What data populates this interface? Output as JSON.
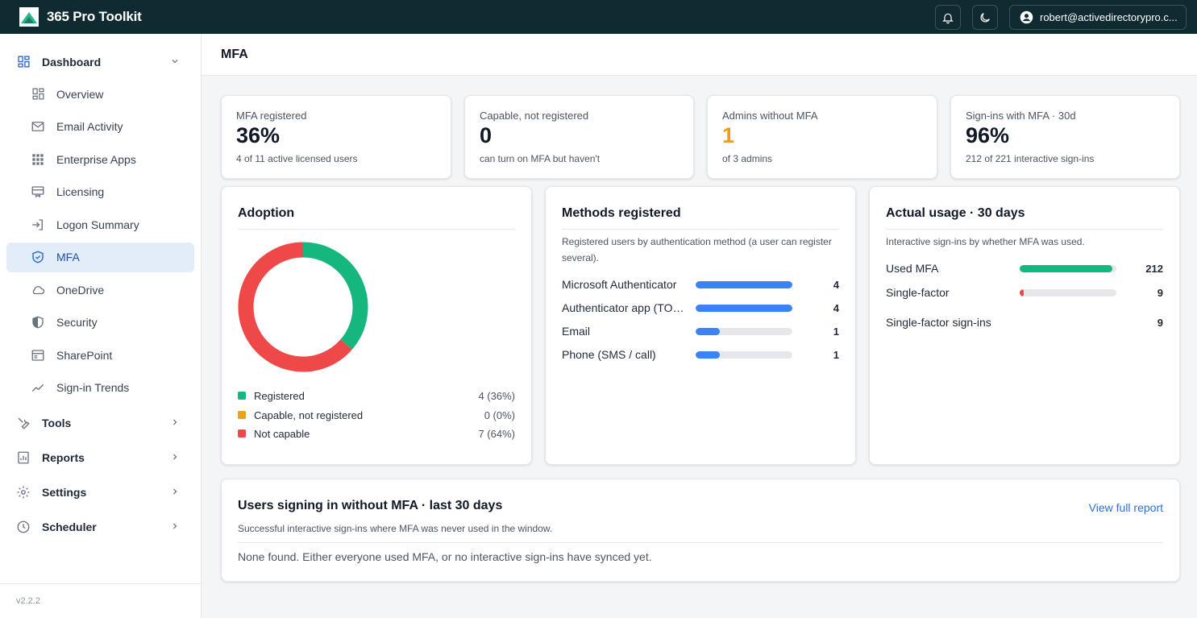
{
  "app": {
    "title": "365 Pro Toolkit",
    "user": "robert@activedirectorypro.c..."
  },
  "sidebar": {
    "dashboard": {
      "label": "Dashboard",
      "items": [
        {
          "label": "Overview",
          "icon": "grid-icon"
        },
        {
          "label": "Email Activity",
          "icon": "mail-icon"
        },
        {
          "label": "Enterprise Apps",
          "icon": "apps-icon"
        },
        {
          "label": "Licensing",
          "icon": "license-icon"
        },
        {
          "label": "Logon Summary",
          "icon": "login-icon"
        },
        {
          "label": "MFA",
          "icon": "shield-check-icon"
        },
        {
          "label": "OneDrive",
          "icon": "cloud-icon"
        },
        {
          "label": "Security",
          "icon": "shield-icon"
        },
        {
          "label": "SharePoint",
          "icon": "browser-icon"
        },
        {
          "label": "Sign-in Trends",
          "icon": "trend-icon"
        }
      ]
    },
    "groups": [
      {
        "label": "Tools",
        "icon": "wrench-icon"
      },
      {
        "label": "Reports",
        "icon": "report-icon"
      },
      {
        "label": "Settings",
        "icon": "gear-icon"
      },
      {
        "label": "Scheduler",
        "icon": "clock-icon"
      }
    ],
    "version": "v2.2.2"
  },
  "page": {
    "title": "MFA"
  },
  "stats": [
    {
      "label": "MFA registered",
      "value": "36%",
      "sub": "4 of 11 active licensed users"
    },
    {
      "label": "Capable, not registered",
      "value": "0",
      "sub": "can turn on MFA but haven't"
    },
    {
      "label": "Admins without MFA",
      "value": "1",
      "sub": "of 3 admins"
    },
    {
      "label": "Sign-ins with MFA · 30d",
      "value": "96%",
      "sub": "212 of 221 interactive sign-ins"
    }
  ],
  "adoption": {
    "title": "Adoption",
    "legend": [
      {
        "label": "Registered",
        "value": "4 (36%)",
        "count": 4,
        "color": "#16b67f"
      },
      {
        "label": "Capable, not registered",
        "value": "0 (0%)",
        "count": 0,
        "color": "#eaa21b"
      },
      {
        "label": "Not capable",
        "value": "7 (64%)",
        "count": 7,
        "color": "#ee4848"
      }
    ]
  },
  "methods": {
    "title": "Methods registered",
    "desc": "Registered users by authentication method (a user can register several).",
    "rows": [
      {
        "label": "Microsoft Authenticator",
        "value": "4",
        "fraction": 1.0
      },
      {
        "label": "Authenticator app (TOTP)",
        "value": "4",
        "fraction": 1.0
      },
      {
        "label": "Email",
        "value": "1",
        "fraction": 0.25
      },
      {
        "label": "Phone (SMS / call)",
        "value": "1",
        "fraction": 0.25
      }
    ]
  },
  "usage": {
    "title": "Actual usage · 30 days",
    "desc": "Interactive sign-ins by whether MFA was used.",
    "rows": [
      {
        "label": "Used MFA",
        "value": "212",
        "fraction": 0.959,
        "color": "#16b67f"
      },
      {
        "label": "Single-factor",
        "value": "9",
        "fraction": 0.041,
        "color": "#ee4848"
      }
    ],
    "extra": {
      "label": "Single-factor sign-ins",
      "value": "9"
    }
  },
  "no_mfa": {
    "title": "Users signing in without MFA · last 30 days",
    "link": "View full report",
    "desc": "Successful interactive sign-ins where MFA was never used in the window.",
    "empty": "None found. Either everyone used MFA, or no interactive sign-ins have synced yet."
  }
}
